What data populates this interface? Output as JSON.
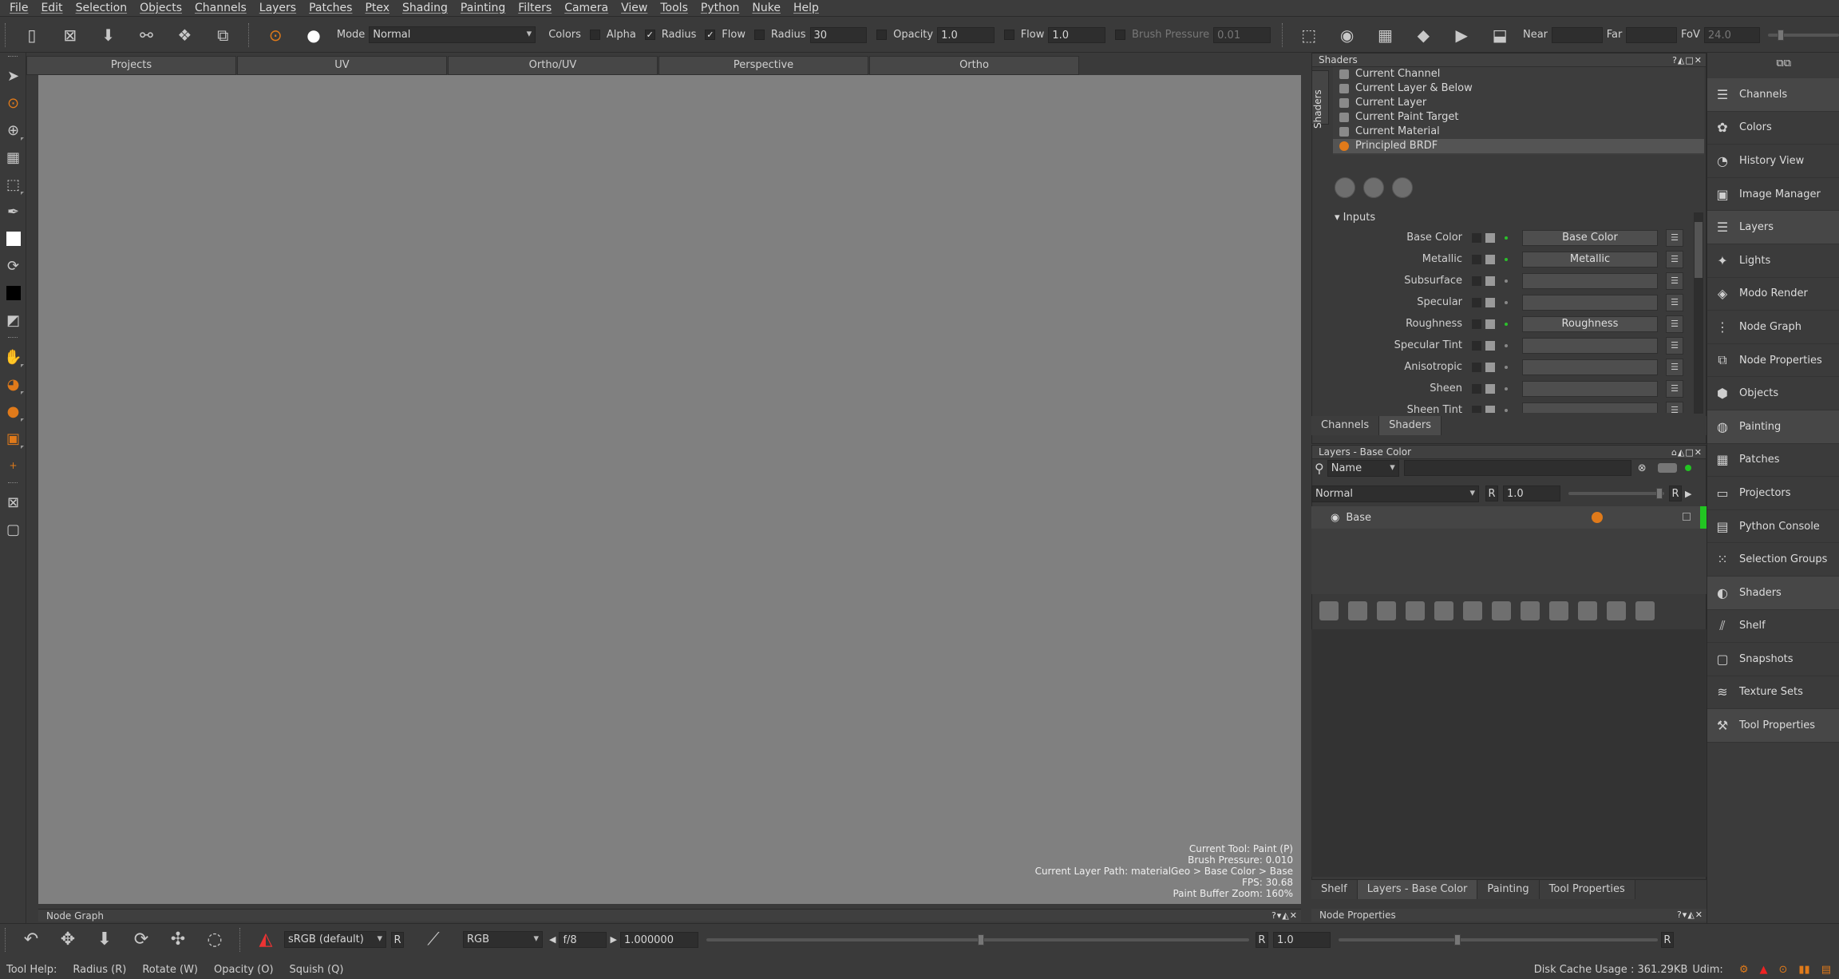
{
  "menu": [
    "File",
    "Edit",
    "Selection",
    "Objects",
    "Channels",
    "Layers",
    "Patches",
    "Ptex",
    "Shading",
    "Painting",
    "Filters",
    "Camera",
    "View",
    "Tools",
    "Python",
    "Nuke",
    "Help"
  ],
  "toolbar": {
    "mode_label": "Mode",
    "mode_value": "Normal",
    "colors_label": "Colors",
    "alpha_label": "Alpha",
    "radius_label": "Radius",
    "flow_label": "Flow",
    "radius2_label": "Radius",
    "radius2_value": "30",
    "opacity_label": "Opacity",
    "opacity_value": "1.0",
    "flow2_label": "Flow",
    "flow2_value": "1.0",
    "brush_pressure_label": "Brush Pressure",
    "brush_pressure_value": "0.01",
    "near_label": "Near",
    "far_label": "Far",
    "fov_label": "FoV",
    "fov_value": "24.0"
  },
  "viewport_tabs": [
    "Projects",
    "UV",
    "Ortho/UV",
    "Perspective",
    "Ortho"
  ],
  "hud": {
    "tool": "Current Tool: Paint (P)",
    "pressure": "Brush Pressure: 0.010",
    "layer_path": "Current Layer Path: materialGeo > Base Color > Base",
    "fps": "FPS: 30.68",
    "zoom": "Paint Buffer Zoom: 160%"
  },
  "node_graph_title": "Node Graph",
  "node_properties_title": "Node Properties",
  "shaders": {
    "title": "Shaders",
    "vtab": "Shaders",
    "items": [
      "Current Channel",
      "Current Layer & Below",
      "Current Layer",
      "Current Paint Target",
      "Current Material",
      "Principled BRDF"
    ],
    "selected_index": 5,
    "inputs_heading": "Inputs",
    "inputs": [
      {
        "label": "Base Color",
        "value": "Base Color",
        "connected": true
      },
      {
        "label": "Metallic",
        "value": "Metallic",
        "connected": true
      },
      {
        "label": "Subsurface",
        "value": "",
        "connected": false
      },
      {
        "label": "Specular",
        "value": "",
        "connected": false
      },
      {
        "label": "Roughness",
        "value": "Roughness",
        "connected": true
      },
      {
        "label": "Specular Tint",
        "value": "",
        "connected": false
      },
      {
        "label": "Anisotropic",
        "value": "",
        "connected": false
      },
      {
        "label": "Sheen",
        "value": "",
        "connected": false
      },
      {
        "label": "Sheen Tint",
        "value": "",
        "connected": false
      }
    ]
  },
  "top_panel_tabs": [
    "Channels",
    "Shaders"
  ],
  "layers": {
    "title": "Layers - Base Color",
    "filter_value": "Name",
    "blend_mode": "Normal",
    "r_label": "R",
    "opacity": "1.0",
    "items": [
      {
        "name": "Base"
      }
    ]
  },
  "bottom_panel_tabs": [
    "Shelf",
    "Layers - Base Color",
    "Painting",
    "Tool Properties"
  ],
  "bottombar": {
    "colorspace": "sRGB (default)",
    "r_label": "R",
    "channel": "RGB",
    "fstop": "f/8",
    "exposure": "1.000000",
    "r2_label": "R",
    "gamma": "1.0"
  },
  "status": {
    "tool_help": "Tool Help:",
    "hints": [
      "Radius (R)",
      "Rotate (W)",
      "Opacity (O)",
      "Squish (Q)"
    ],
    "disk_cache": "Disk Cache Usage : 361.29KB",
    "udim": "Udim:"
  },
  "sidebar": [
    "Channels",
    "Colors",
    "History View",
    "Image Manager",
    "Layers",
    "Lights",
    "Modo Render",
    "Node Graph",
    "Node Properties",
    "Objects",
    "Painting",
    "Patches",
    "Projectors",
    "Python Console",
    "Selection Groups",
    "Shaders",
    "Shelf",
    "Snapshots",
    "Texture Sets",
    "Tool Properties"
  ],
  "sidebar_highlighted": [
    "Channels",
    "Layers",
    "Painting",
    "Shaders",
    "Tool Properties"
  ],
  "sidebar_icons": [
    "list-icon",
    "colors-icon",
    "history-icon",
    "image-icon",
    "layers-icon",
    "light-icon",
    "render-icon",
    "node-graph-icon",
    "node-properties-icon",
    "objects-icon",
    "painting-icon",
    "patches-icon",
    "projector-icon",
    "python-icon",
    "selection-icon",
    "shaders-icon",
    "shelf-icon",
    "snapshot-icon",
    "texture-icon",
    "tool-icon"
  ]
}
